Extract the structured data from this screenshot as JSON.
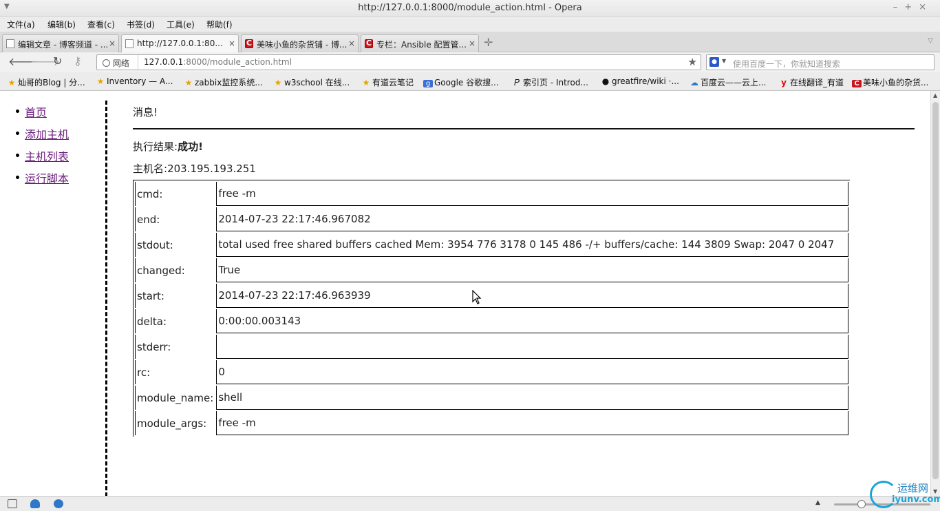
{
  "window": {
    "title": "http://127.0.0.1:8000/module_action.html - Opera",
    "controls": [
      "–",
      "+",
      "×"
    ]
  },
  "menu": [
    "文件(a)",
    "编辑(b)",
    "查看(c)",
    "书签(d)",
    "工具(e)",
    "帮助(f)"
  ],
  "tabs": [
    {
      "label": "编辑文章 - 博客频道 - ...",
      "icon": "page-icon",
      "active": false
    },
    {
      "label": "http://127.0.0.1:80...",
      "icon": "page-icon",
      "active": true
    },
    {
      "label": "美味小鱼的杂货铺 - 博...",
      "icon": "csdn-icon",
      "active": false
    },
    {
      "label": "专栏：Ansible 配置管...",
      "icon": "csdn-icon",
      "active": false
    }
  ],
  "address": {
    "zone_label": "网络",
    "url_host": "127.0.0.1",
    "url_rest": ":8000/module_action.html",
    "search_placeholder": "使用百度一下，你就知道搜索"
  },
  "bookmarks": [
    {
      "label": "灿哥的Blog | 分...",
      "icon": "star-icon"
    },
    {
      "label": "Inventory — A...",
      "icon": "star-icon"
    },
    {
      "label": "zabbix监控系统...",
      "icon": "star-icon"
    },
    {
      "label": "w3school 在线...",
      "icon": "star-icon"
    },
    {
      "label": "有道云笔记",
      "icon": "star-icon"
    },
    {
      "label": "Google 谷歌搜...",
      "icon": "google-icon"
    },
    {
      "label": "索引页 - Introd...",
      "icon": "python-icon"
    },
    {
      "label": "greatfire/wiki ·...",
      "icon": "github-icon"
    },
    {
      "label": "百度云——云上...",
      "icon": "baidu-cloud-icon"
    },
    {
      "label": "在线翻译_有道",
      "icon": "youdao-icon"
    },
    {
      "label": "美味小鱼的杂货...",
      "icon": "csdn-icon"
    }
  ],
  "sidebar": {
    "items": [
      "首页",
      "添加主机",
      "主机列表",
      "运行脚本"
    ]
  },
  "main": {
    "message": "消息!",
    "result_prefix": "执行结果:",
    "result_value": "成功!",
    "hostname_prefix": "主机名:",
    "hostname_value": "203.195.193.251",
    "rows": [
      {
        "key": "cmd:",
        "value": "free -m"
      },
      {
        "key": "end:",
        "value": "2014-07-23 22:17:46.967082"
      },
      {
        "key": "stdout:",
        "value": "total used free shared buffers cached Mem: 3954 776 3178 0 145 486 -/+ buffers/cache: 144 3809 Swap: 2047 0 2047"
      },
      {
        "key": "changed:",
        "value": "True"
      },
      {
        "key": "start:",
        "value": "2014-07-23 22:17:46.963939"
      },
      {
        "key": "delta:",
        "value": "0:00:00.003143"
      },
      {
        "key": "stderr:",
        "value": ""
      },
      {
        "key": "rc:",
        "value": "0"
      },
      {
        "key": "module_name:",
        "value": "shell"
      },
      {
        "key": "module_args:",
        "value": "free -m"
      }
    ]
  },
  "watermark": {
    "cn": "运维网",
    "en": "iyunv.com"
  }
}
